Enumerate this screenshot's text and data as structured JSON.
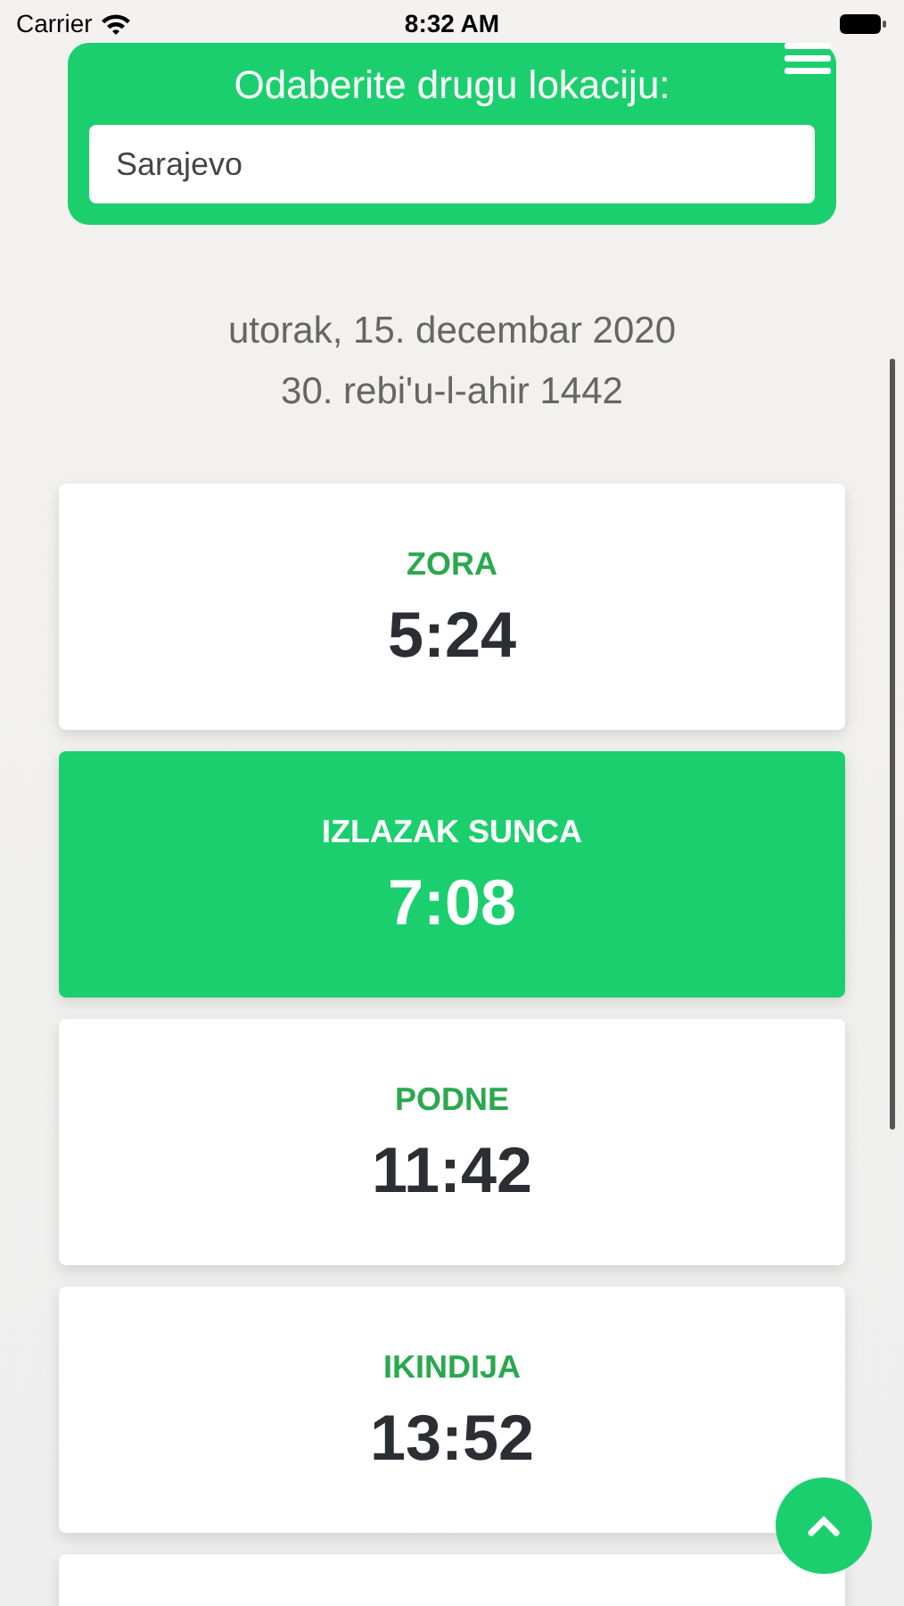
{
  "status_bar": {
    "carrier": "Carrier",
    "time": "8:32 AM"
  },
  "location": {
    "title": "Odaberite drugu lokaciju:",
    "value": "Sarajevo"
  },
  "dates": [
    "utorak, 15. decembar 2020",
    "30. rebi'u-l-ahir 1442"
  ],
  "prayers": [
    {
      "name": "ZORA",
      "time": "5:24",
      "selected": false
    },
    {
      "name": "IZLAZAK SUNCA",
      "time": "7:08",
      "selected": true
    },
    {
      "name": "PODNE",
      "time": "11:42",
      "selected": false
    },
    {
      "name": "IKINDIJA",
      "time": "13:52",
      "selected": false
    }
  ]
}
